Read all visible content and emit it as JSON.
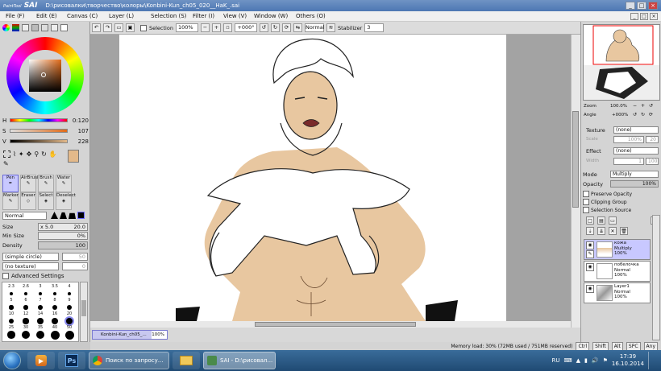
{
  "window": {
    "app": "PaintTool",
    "app_sai": "SAI",
    "title": "D:\\рисовалки\\творчество\\колоры\\Konbini-Kun_ch05_020__HaK_.sai",
    "controls": [
      "_",
      "□",
      "×"
    ]
  },
  "menu": [
    "File (F)",
    "Edit (E)",
    "Canvas (C)",
    "Layer (L)",
    "Selection (S)",
    "Filter (I)",
    "View (V)",
    "Window (W)",
    "Others (O)"
  ],
  "color": {
    "h_label": "H",
    "h_value": "0:120",
    "s_label": "S",
    "s_value": "107",
    "v_label": "V",
    "v_value": "228",
    "current": "#e3b98a"
  },
  "tools": [
    "Pen",
    "AirBrush",
    "Brush",
    "Water",
    "Marker",
    "Eraser",
    "Select",
    "Deselect"
  ],
  "brush": {
    "mode": "Normal",
    "size_label": "Size",
    "size_mult": "x 5.0",
    "size_value": "20.0",
    "minsize_label": "Min Size",
    "minsize_value": "0%",
    "density_label": "Density",
    "density_value": "100",
    "shape": "(simple circle)",
    "shape_val": "50",
    "texture": "(no texture)",
    "texture_val": "0",
    "advanced": "Advanced Settings",
    "sizes": [
      "2.3",
      "2.6",
      "3",
      "3.5",
      "4",
      "5",
      "6",
      "7",
      "8",
      "9",
      "10",
      "12",
      "14",
      "16",
      "20",
      "25",
      "30",
      "35",
      "40",
      "50"
    ]
  },
  "toolbar": {
    "selection": "Selection",
    "zoom": "100%",
    "angle": "+000°",
    "mode": "Normal",
    "stabilizer_label": "Stabilizer",
    "stabilizer": "3"
  },
  "doc_tab": {
    "name": "Konbini-Kun_ch05_...",
    "zoom": "100%"
  },
  "navigator": {
    "zoom_label": "Zoom",
    "zoom": "100.0%",
    "angle_label": "Angle",
    "angle": "+000%"
  },
  "layer_props": {
    "texture_label": "Texture",
    "texture": "(none)",
    "scale_label": "Scale",
    "scale": "100%",
    "scale_val": "20",
    "effect_label": "Effect",
    "effect": "(none)",
    "width_label": "Width",
    "width": "1",
    "width_val": "100",
    "mode_label": "Mode",
    "mode": "Multiply",
    "opacity_label": "Opacity",
    "opacity": "100%",
    "preserve_opacity": "Preserve Opacity",
    "clipping_group": "Clipping Group",
    "selection_source": "Selection Source"
  },
  "layers": [
    {
      "name": "кожа",
      "mode": "Multiply",
      "opacity": "100%"
    },
    {
      "name": "побелочка",
      "mode": "Normal",
      "opacity": "100%"
    },
    {
      "name": "Layer1",
      "mode": "Normal",
      "opacity": "100%"
    }
  ],
  "status": {
    "memory": "Memory load: 30% (72MB used / 751MB reserved)",
    "keys": [
      "Ctrl",
      "Shift",
      "Alt",
      "SPC",
      "Any"
    ]
  },
  "taskbar": {
    "ps_label": "Ps",
    "chrome_label": "Поиск по запросу...",
    "sai_label": "SAI - D:\\рисовал...",
    "lang": "RU",
    "time": "17:39",
    "date": "16.10.2014"
  }
}
